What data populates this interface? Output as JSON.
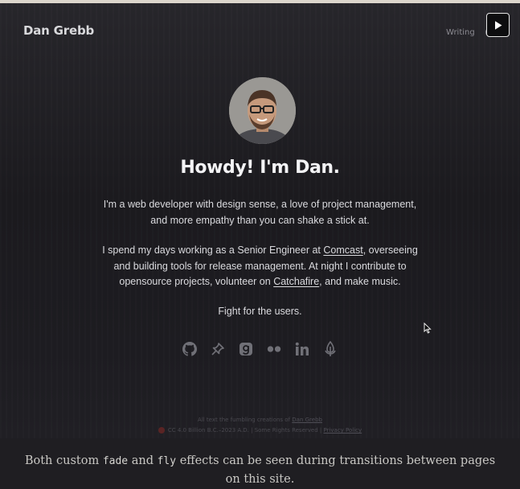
{
  "header": {
    "site_title": "Dan Grebb",
    "nav_writing": "Writing"
  },
  "hero": {
    "headline": "Howdy! I'm Dan.",
    "para1_line1": "I'm a web developer with design sense, a love of project management,",
    "para1_line2": "and more empathy than you can shake a stick at.",
    "para2_part1": "I spend my days working as a Senior Engineer at ",
    "para2_link1": "Comcast",
    "para2_part2": ", overseeing",
    "para2_line2": "and building tools for release management. At night I contribute to",
    "para2_part3": "opensource projects, volunteer on ",
    "para2_link2": "Catchafire",
    "para2_part4": ", and make music.",
    "para3": "Fight for the users."
  },
  "socials": [
    {
      "icon": "github-icon"
    },
    {
      "icon": "pin-icon"
    },
    {
      "icon": "goodreads-icon"
    },
    {
      "icon": "flickr-icon"
    },
    {
      "icon": "linkedin-icon"
    },
    {
      "icon": "podcast-icon"
    }
  ],
  "footer": {
    "line1_prefix": "All text the fumbling creations of ",
    "line1_link": "Dan Grebb",
    "line2_text": "CC 4.0 Billion B.C.–2023 A.D. | Some Rights Reserved | ",
    "line2_link": "Privacy Policy"
  },
  "caption": {
    "part1": "Both custom ",
    "code1": "fade",
    "part2": " and ",
    "code2": "fly",
    "part3": " effects can be seen during transitions between pages on this site."
  },
  "colors": {
    "background": "#1b1a1e",
    "text": "#dadade",
    "headline": "#f3f3f5",
    "top_border": "#dcd6cc"
  }
}
